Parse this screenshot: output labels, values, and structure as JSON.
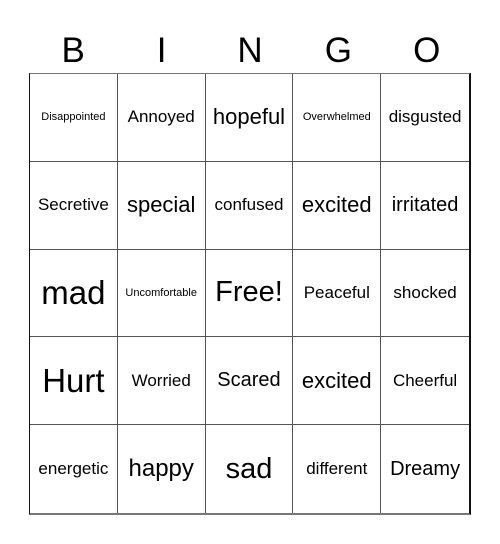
{
  "header": {
    "letters": [
      "B",
      "I",
      "N",
      "G",
      "O"
    ]
  },
  "board": {
    "cells": [
      {
        "text": "Disappointed",
        "size": "s11"
      },
      {
        "text": "Annoyed",
        "size": "s17"
      },
      {
        "text": "hopeful",
        "size": "s22"
      },
      {
        "text": "Overwhelmed",
        "size": "s11"
      },
      {
        "text": "disgusted",
        "size": "s17"
      },
      {
        "text": "Secretive",
        "size": "s17"
      },
      {
        "text": "special",
        "size": "s22"
      },
      {
        "text": "confused",
        "size": "s17"
      },
      {
        "text": "excited",
        "size": "s22"
      },
      {
        "text": "irritated",
        "size": "s20"
      },
      {
        "text": "mad",
        "size": "s33"
      },
      {
        "text": "Uncomfortable",
        "size": "s11"
      },
      {
        "text": "Free!",
        "size": "s29"
      },
      {
        "text": "Peaceful",
        "size": "s17"
      },
      {
        "text": "shocked",
        "size": "s17"
      },
      {
        "text": "Hurt",
        "size": "s33"
      },
      {
        "text": "Worried",
        "size": "s17"
      },
      {
        "text": "Scared",
        "size": "s20"
      },
      {
        "text": "excited",
        "size": "s22"
      },
      {
        "text": "Cheerful",
        "size": "s17"
      },
      {
        "text": "energetic",
        "size": "s17"
      },
      {
        "text": "happy",
        "size": "s24"
      },
      {
        "text": "sad",
        "size": "s29"
      },
      {
        "text": "different",
        "size": "s17"
      },
      {
        "text": "Dreamy",
        "size": "s20"
      }
    ]
  }
}
